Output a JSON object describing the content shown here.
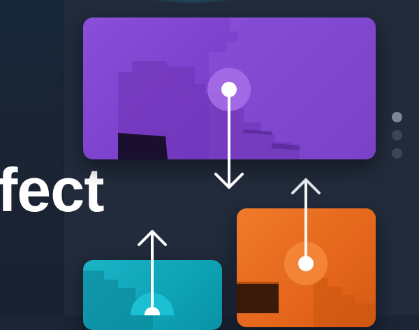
{
  "hero": {
    "headline": "fect"
  },
  "cards": [
    {
      "id": "purple",
      "color": "#7b3fcc"
    },
    {
      "id": "orange",
      "color": "#e96a1f"
    },
    {
      "id": "teal",
      "color": "#11aabd"
    }
  ],
  "pager": {
    "total": 3,
    "active_index": 0
  },
  "arrows": [
    {
      "direction": "down",
      "color": "#ffffff"
    },
    {
      "direction": "up",
      "color": "#ffffff"
    },
    {
      "direction": "up",
      "color": "#ffffff"
    }
  ]
}
